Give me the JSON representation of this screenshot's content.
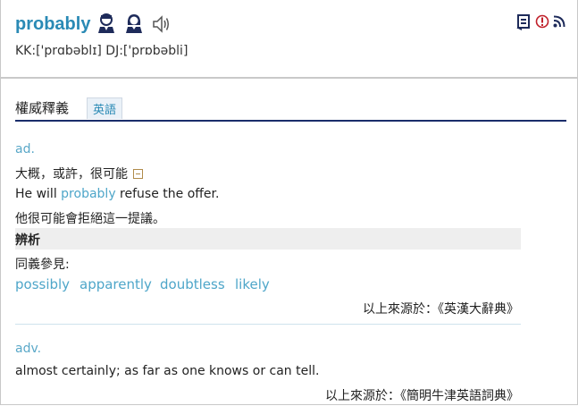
{
  "header": {
    "word": "probably",
    "phonetic": "KK:['prɑbəblɪ] DJ:['prɒbəbli]"
  },
  "icons": {
    "male_voice": "male-voice-icon",
    "female_voice": "female-voice-icon",
    "speaker": "speaker-icon",
    "wordbook": "wordbook-icon",
    "report": "report-icon",
    "rss": "rss-icon"
  },
  "tabs": {
    "title": "權威釋義",
    "active": "英語"
  },
  "entry1": {
    "pos": "ad.",
    "definition": "大概，或許，很可能",
    "example_before": "He will ",
    "example_highlight": "probably",
    "example_after": " refuse the offer.",
    "translation": "他很可能會拒絕這一提議。",
    "section": "辨析",
    "synonym_label": "同義參見:",
    "synonyms": [
      "possibly",
      "apparently",
      "doubtless",
      "likely"
    ],
    "source": "以上來源於：《英漢大辭典》"
  },
  "entry2": {
    "pos": "adv.",
    "definition": "almost certainly; as far as one knows or can tell.",
    "source": "以上來源於：《簡明牛津英語詞典》"
  },
  "colors": {
    "accent": "#2a8ab5",
    "link": "#4ea6c9",
    "rule": "#1a2d6b"
  }
}
